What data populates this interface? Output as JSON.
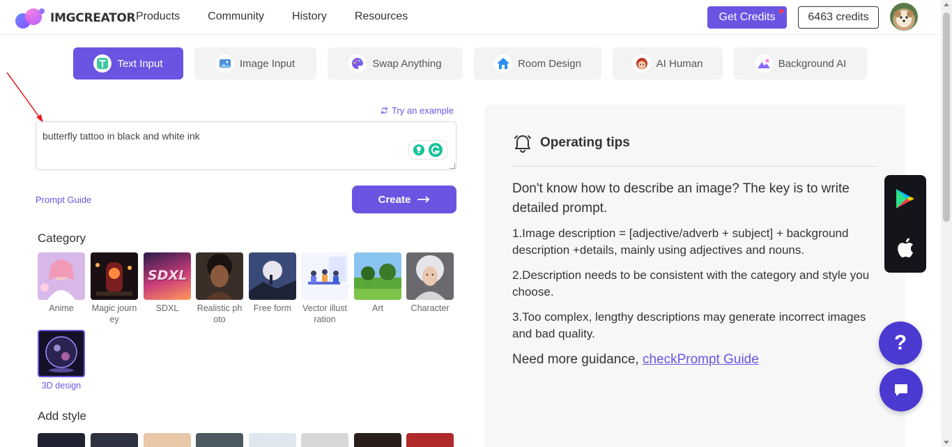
{
  "header": {
    "logo_text": "IMGCREATOR",
    "nav": [
      "Products",
      "Community",
      "History",
      "Resources"
    ],
    "get_credits_label": "Get Credits",
    "credits_label": "6463 credits"
  },
  "tabs": [
    {
      "label": "Text Input",
      "icon": "text-input-icon",
      "active": true
    },
    {
      "label": "Image Input",
      "icon": "image-input-icon",
      "active": false
    },
    {
      "label": "Swap Anything",
      "icon": "palette-icon",
      "active": false
    },
    {
      "label": "Room Design",
      "icon": "house-icon",
      "active": false
    },
    {
      "label": "AI Human",
      "icon": "face-icon",
      "active": false
    },
    {
      "label": "Background AI",
      "icon": "mountain-icon",
      "active": false
    }
  ],
  "prompt": {
    "try_example_label": "Try an example",
    "value": "butterfly tattoo in black and white ink",
    "guide_label": "Prompt Guide",
    "create_label": "Create"
  },
  "category": {
    "title": "Category",
    "items": [
      {
        "label": "Anime",
        "selected": false
      },
      {
        "label": "Magic journey",
        "selected": false
      },
      {
        "label": "SDXL",
        "selected": false
      },
      {
        "label": "Realistic photo",
        "selected": false
      },
      {
        "label": "Free form",
        "selected": false
      },
      {
        "label": "Vector illustration",
        "selected": false
      },
      {
        "label": "Art",
        "selected": false
      },
      {
        "label": "Character",
        "selected": false
      },
      {
        "label": "3D design",
        "selected": true
      }
    ],
    "sdxl_thumb_text": "SDXL"
  },
  "style": {
    "title": "Add style"
  },
  "tips": {
    "title": "Operating tips",
    "lead": "Don't know how to describe an image? The key is to write detailed prompt.",
    "points": [
      "1.Image description = [adjective/adverb + subject] + background description +details, mainly using adjectives and nouns.",
      "2.Description needs to be consistent with the category and style you choose.",
      "3.Too complex, lengthy descriptions may generate incorrect images and bad quality."
    ],
    "more_prefix": "Need more guidance, ",
    "more_link": "checkPrompt Guide"
  },
  "floating": {
    "help_label": "?"
  },
  "colors": {
    "accent": "#6a55e3",
    "fab": "#4b3ad1",
    "panel_bg": "#f7f7f7"
  }
}
